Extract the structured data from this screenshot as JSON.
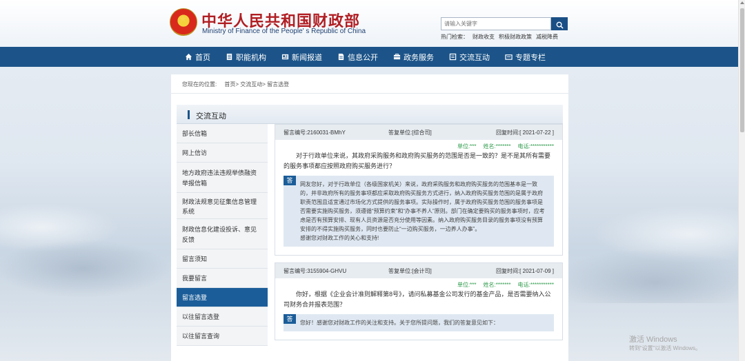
{
  "site": {
    "title_cn": "中华人民共和国财政部",
    "title_en": "Ministry of Finance of the People' s Republic of China"
  },
  "search": {
    "placeholder": "请输入关键字",
    "hot_label": "热门检索：",
    "hot_terms": [
      "财政收支",
      "积极财政政策",
      "减税降费"
    ]
  },
  "nav": {
    "items": [
      {
        "label": "首页",
        "icon": "home-icon"
      },
      {
        "label": "职能机构",
        "icon": "document-icon"
      },
      {
        "label": "新闻报道",
        "icon": "news-icon"
      },
      {
        "label": "信息公开",
        "icon": "file-icon"
      },
      {
        "label": "政务服务",
        "icon": "service-icon"
      },
      {
        "label": "交流互动",
        "icon": "interact-icon"
      },
      {
        "label": "专题专栏",
        "icon": "folder-icon"
      }
    ]
  },
  "breadcrumb": {
    "prefix": "您现在的位置:",
    "items": [
      "首页>",
      "交流互动>",
      "留言选登"
    ]
  },
  "section": {
    "title": "交流互动"
  },
  "sidebar": {
    "items": [
      {
        "label": "部长信箱"
      },
      {
        "label": "网上信访"
      },
      {
        "label": "地方政府违法违规举债融资举报信箱"
      },
      {
        "label": "财政法规意见征集信息管理系统"
      },
      {
        "label": "财政信息化建设投诉、意见反馈"
      },
      {
        "label": "留言须知"
      },
      {
        "label": "我要留言"
      },
      {
        "label": "留言选登"
      },
      {
        "label": "以往留言选登"
      },
      {
        "label": "以往留言查询"
      }
    ]
  },
  "messages": [
    {
      "code": "留言编号:2160031-BMhY",
      "unit": "答复单位:[综合司]",
      "reply_time": "回复时间:[ 2021-07-22 ]",
      "meta_unit": "单位:***",
      "meta_name": "姓名:*******",
      "meta_phone": "电话:***********",
      "question": "对于行政单位来说，其政府采购服务和政府购买服务的范围是否是一致的？是不是其所有需要的服务事项都应按照政府购买服务进行？",
      "answer_badge": "答",
      "answer": "网友您好，对于行政单位（各级国家机关）来说，政府采购服务和政府购买服务的范围基本是一致的，并非政府所有的服务事项都应采取政府购买服务方式进行，纳入政府购买服务范围的是属于政府职责范围且适宜通过市场化方式提供的服务事项。实际操作时，属于政府购买服务范围的服务事项是否需要实施购买服务，须遵循“预算约束”和“办事不养人”原则。部门在确定要购买的服务事项时，应考虑是否有预算安排、现有人员资源是否充分使用等因素。纳入政府购买服务目录的服务事项没有预算安排的不得实施购买服务，同时也要防止“一边购买服务，一边养人办事”。",
      "answer_thanks": "感谢您对财政工作的关心和支持!"
    },
    {
      "code": "留言编号:3155904-GHVU",
      "unit": "答复单位:[会计司]",
      "reply_time": "回复时间:[ 2021-07-09 ]",
      "meta_unit": "单位:***",
      "meta_name": "姓名:*******",
      "meta_phone": "电话:***********",
      "question": "你好，根据《企业会计准则解释第8号》，请问私募基金公司发行的基金产品，是否需要纳入公司财务合并报表范围？",
      "answer_badge": "答",
      "answer": "您好！感谢您对财政工作的关注和支持。关于您所提问题，我们的答复意见如下："
    }
  ],
  "watermark": {
    "line1": "激活 Windows",
    "line2": "转到“设置”以激活 Windows。"
  }
}
